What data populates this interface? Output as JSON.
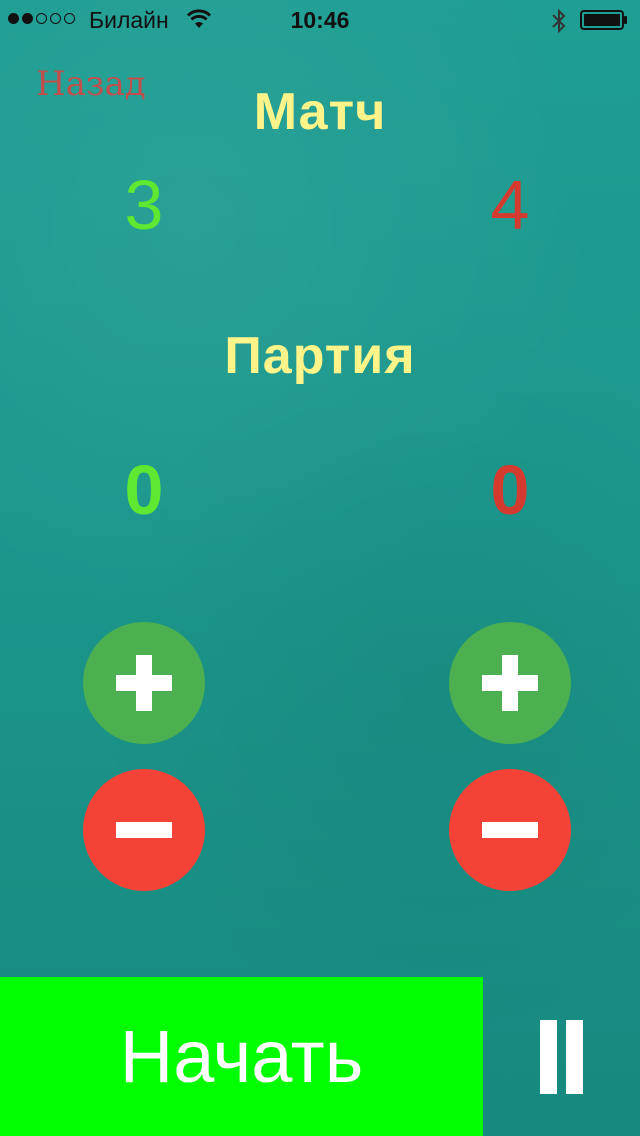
{
  "status_bar": {
    "carrier": "Билайн",
    "time": "10:46",
    "signal_icon": "signal-dots-icon",
    "wifi_icon": "wifi-icon",
    "bluetooth_icon": "bluetooth-icon",
    "battery_icon": "battery-icon"
  },
  "nav": {
    "back_label": "Назад"
  },
  "match": {
    "title": "Матч",
    "left_score": "3",
    "right_score": "4"
  },
  "party": {
    "title": "Партия",
    "left_score": "0",
    "right_score": "0"
  },
  "controls": {
    "plus_icon": "plus-icon",
    "minus_icon": "minus-icon"
  },
  "footer": {
    "start_label": "Начать",
    "pause_icon": "pause-icon"
  },
  "colors": {
    "background": "#1b968b",
    "title": "#fff48a",
    "left_player": "#5fe832",
    "right_player": "#d53a2e",
    "plus": "#4caf50",
    "minus": "#f44336",
    "start": "#00ff00"
  }
}
